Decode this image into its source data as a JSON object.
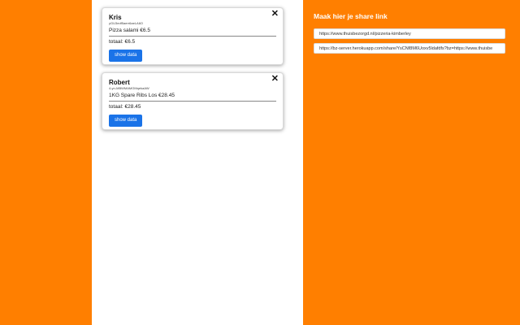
{
  "orders": [
    {
      "name": "Kris",
      "uid": "yGU3edf5aerr6aeLA6O",
      "item": "Pizza salami €6.5",
      "total": "totaal: €6.5",
      "button": "show data",
      "close": "✕"
    },
    {
      "name": "Robert",
      "uid": "4-yn-MBWMAMGMqekaAW",
      "item": "1KG Spare Ribs Los €28.45",
      "total": "totaal: €28.45",
      "button": "show data",
      "close": "✕"
    }
  ],
  "share": {
    "title": "Maak hier je share link",
    "source_url": "https://www.thuisbezorgd.nl/pizzeria-kimberley",
    "share_url": "https://bz-server.herokuapp.com/share/YsCNf8M6Uoxv5ldafdfs?bz=https://www.thuisbe"
  },
  "colors": {
    "background": "#ff7f00",
    "button": "#1a73e8"
  }
}
